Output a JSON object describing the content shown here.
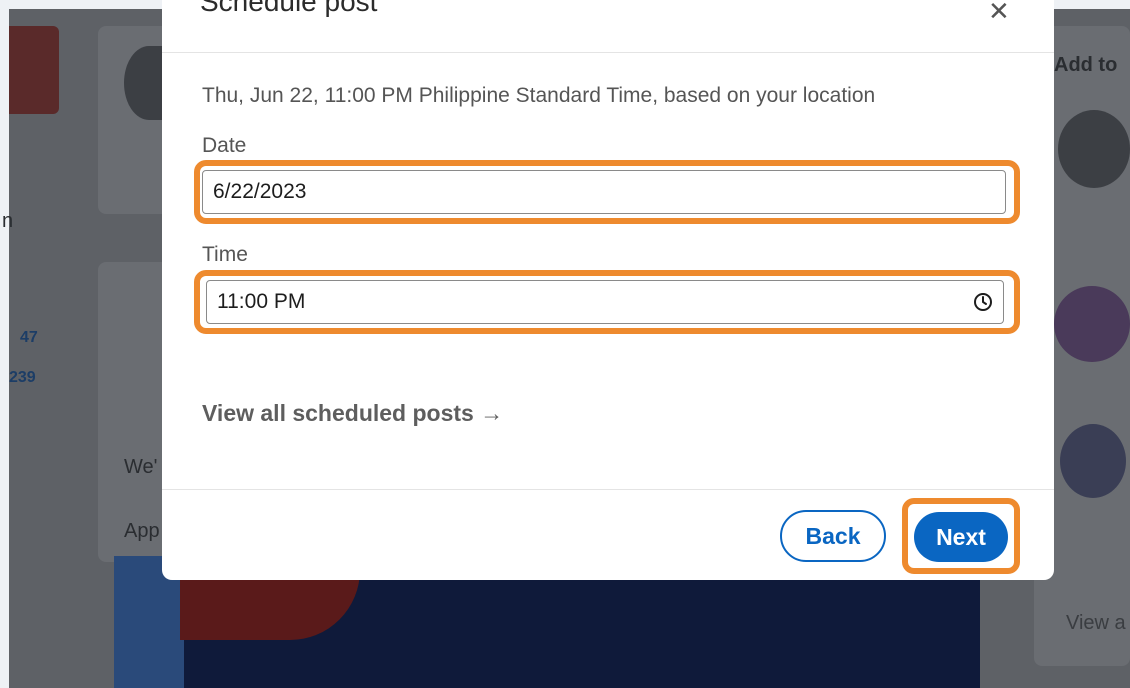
{
  "modal": {
    "title": "Schedule post",
    "close_icon": "close-icon",
    "info_text": "Thu, Jun 22, 11:00 PM Philippine Standard Time, based on your location",
    "date_label": "Date",
    "date_value": "6/22/2023",
    "time_label": "Time",
    "time_value": "11:00 PM",
    "time_icon": "clock-icon",
    "view_all_label": "View all scheduled posts →",
    "back_label": "Back",
    "next_label": "Next"
  },
  "background": {
    "right_panel_title": "Add to",
    "stat_1": "47",
    "stat_2": "239",
    "post_text_1": "We'",
    "post_text_2": "App",
    "right_view": "View a",
    "left_fragment": "n"
  },
  "colors": {
    "accent": "#0a66c2",
    "highlight": "#ee8a2e",
    "overlay": "#5e6166"
  }
}
